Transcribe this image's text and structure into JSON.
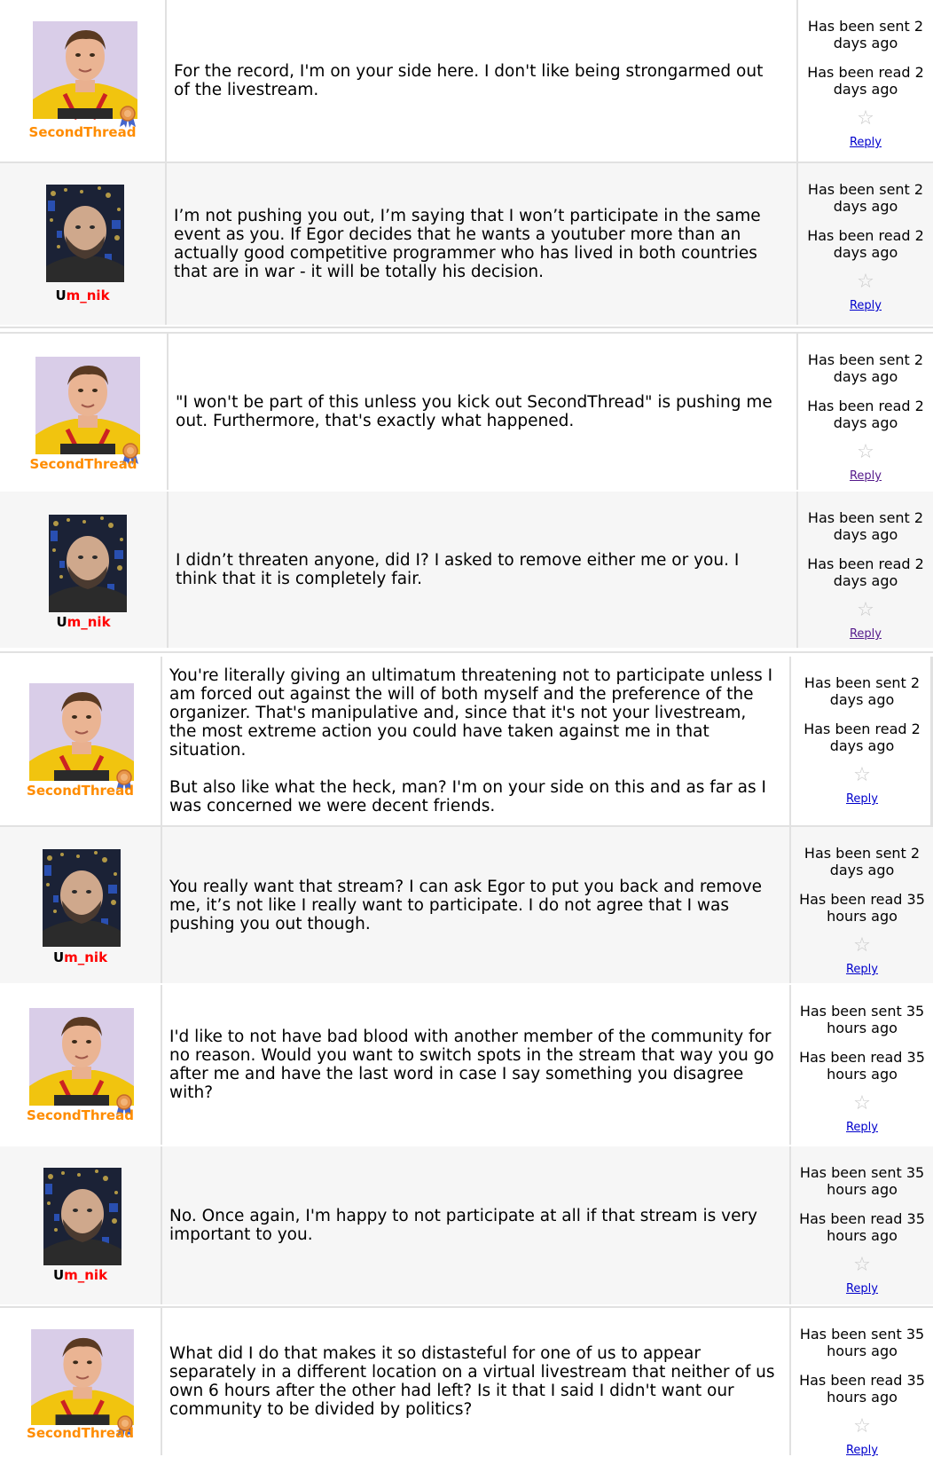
{
  "colors": {
    "link": "#0000cc",
    "visited_link": "#551a8b",
    "orange_handle": "#ff8c00",
    "red_handle": "#ff0000",
    "row_alt": "#f6f6f6",
    "border": "#e1e1e1"
  },
  "messages": [
    {
      "author": "SecondThread",
      "handle_style": "orange",
      "avatar": "person-yellow-shirt",
      "badge": "ribbon-medal-icon",
      "paragraphs": [
        "For the record, I'm on your side here. I don't like being strongarmed out of the livestream."
      ],
      "sent": "Has been sent 2 days ago",
      "read": "Has been read 2 days ago",
      "star": "☆",
      "reply": "Reply"
    },
    {
      "author": "Um_nik",
      "handle_style": "red",
      "handle_first": "U",
      "handle_rest": "m_nik",
      "avatar": "person-dark-background",
      "paragraphs": [
        "I’m not pushing you out, I’m saying that I won’t participate in the same event as you. If Egor decides that he wants a youtuber more than an actually good competitive programmer who has lived in both countries that are in war - it will be totally his decision."
      ],
      "sent": "Has been sent 2 days ago",
      "read": "Has been read 2 days ago",
      "star": "☆",
      "reply": "Reply"
    },
    {
      "author": "SecondThread",
      "handle_style": "orange",
      "avatar": "person-yellow-shirt",
      "badge": "ribbon-medal-icon",
      "paragraphs": [
        "\"I won't be part of this unless you kick out SecondThread\" is pushing me out. Furthermore, that's exactly what happened."
      ],
      "sent": "Has been sent 2 days ago",
      "read": "Has been read 2 days ago",
      "star": "☆",
      "reply": "Reply"
    },
    {
      "author": "Um_nik",
      "handle_style": "red",
      "handle_first": "U",
      "handle_rest": "m_nik",
      "avatar": "person-dark-background",
      "paragraphs": [
        "I didn’t threaten anyone, did I? I asked to remove either me or you. I think that it is completely fair."
      ],
      "sent": "Has been sent 2 days ago",
      "read": "Has been read 2 days ago",
      "star": "☆",
      "reply": "Reply"
    },
    {
      "author": "SecondThread",
      "handle_style": "orange",
      "avatar": "person-yellow-shirt",
      "badge": "ribbon-medal-icon",
      "paragraphs": [
        "You're literally giving an ultimatum threatening not to participate unless I am forced out against the will of both myself and the preference of the organizer. That's manipulative and, since that it's not your livestream, the most extreme action you could have taken against me in that situation.",
        "But also like what the heck, man? I'm on your side on this and as far as I was concerned we were decent friends."
      ],
      "sent": "Has been sent 2 days ago",
      "read": "Has been read 2 days ago",
      "star": "☆",
      "reply": "Reply"
    },
    {
      "author": "Um_nik",
      "handle_style": "red",
      "handle_first": "U",
      "handle_rest": "m_nik",
      "avatar": "person-dark-background",
      "paragraphs": [
        "You really want that stream? I can ask Egor to put you back and remove me, it’s not like I really want to participate. I do not agree that I was pushing you out though."
      ],
      "sent": "Has been sent 2 days ago",
      "read": "Has been read 35 hours ago",
      "star": "☆",
      "reply": "Reply"
    },
    {
      "author": "SecondThread",
      "handle_style": "orange",
      "avatar": "person-yellow-shirt",
      "badge": "ribbon-medal-icon",
      "paragraphs": [
        "I'd like to not have bad blood with another member of the community for no reason. Would you want to switch spots in the stream that way you go after me and have the last word in case I say something you disagree with?"
      ],
      "sent": "Has been sent 35 hours ago",
      "read": "Has been read 35 hours ago",
      "star": "☆",
      "reply": "Reply"
    },
    {
      "author": "Um_nik",
      "handle_style": "red",
      "handle_first": "U",
      "handle_rest": "m_nik",
      "avatar": "person-dark-background",
      "paragraphs": [
        "No. Once again, I'm happy to not participate at all if that stream is very important to you."
      ],
      "sent": "Has been sent 35 hours ago",
      "read": "Has been read 35 hours ago",
      "star": "☆",
      "reply": "Reply"
    },
    {
      "author": "SecondThread",
      "handle_style": "orange",
      "avatar": "person-yellow-shirt",
      "badge": "ribbon-medal-icon",
      "paragraphs": [
        "What did I do that makes it so distasteful for one of us to appear separately in a different location on a virtual livestream that neither of us own 6 hours after the other had left? Is it that I said I didn't want our community to be divided by politics?"
      ],
      "sent": "Has been sent 35 hours ago",
      "read": "Has been read 35 hours ago",
      "star": "☆",
      "reply": "Reply"
    }
  ]
}
